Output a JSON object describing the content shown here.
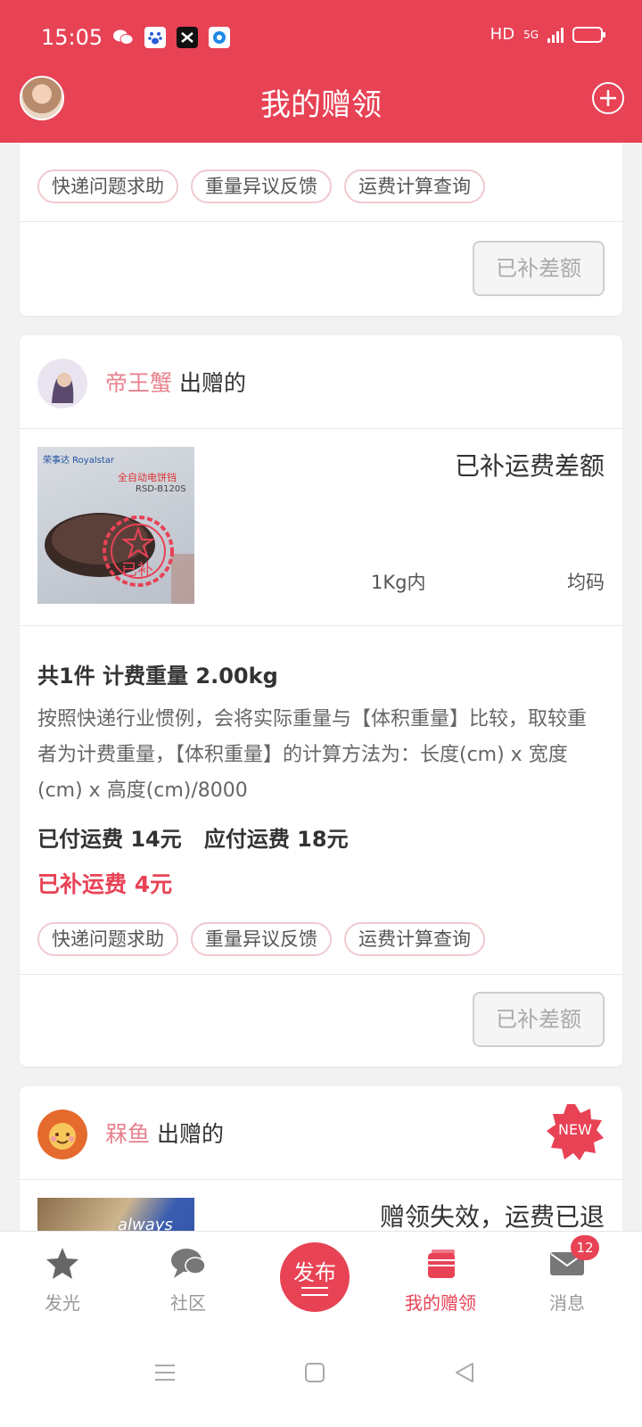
{
  "status_bar": {
    "time": "15:05",
    "hd": "HD",
    "network": "5G"
  },
  "header": {
    "title": "我的赠领"
  },
  "colors": {
    "primary": "#e84255",
    "giver_name": "#e8838f",
    "tag_border": "#f0c9ce"
  },
  "cards": [
    {
      "tags": [
        "快递问题求助",
        "重量异议反馈",
        "运费计算查询"
      ],
      "action_label": "已补差额"
    },
    {
      "giver_name": "帝王蟹",
      "giver_suffix": "出赠的",
      "product_status": "已补运费差额",
      "weight_range": "1Kg内",
      "size": "均码",
      "stamp_text": "已补",
      "product_brand": "荣事达 Royalstar",
      "product_model": "RSD-B120S",
      "product_name": "全自动电饼铛",
      "summary": "共1件 计费重量 2.00kg",
      "description": "按照快递行业惯例，会将实际重量与【体积重量】比较，取较重者为计费重量，【体积重量】的计算方法为：长度(cm) x 宽度(cm) x 高度(cm)/8000",
      "fee_line": "已付运费 14元   应付运费 18元",
      "fee_paid": "已补运费 4元",
      "tags": [
        "快递问题求助",
        "重量异议反馈",
        "运费计算查询"
      ],
      "action_label": "已补差额"
    },
    {
      "giver_name": "槑鱼",
      "giver_suffix": "出赠的",
      "badge": "NEW",
      "product_status": "赠领失效，运费已退",
      "product_label": "always"
    }
  ],
  "bottom_nav": {
    "items": [
      {
        "label": "发光",
        "icon": "star-icon"
      },
      {
        "label": "社区",
        "icon": "chat-bubble-icon"
      },
      {
        "label": "我的赠领",
        "icon": "gift-box-icon"
      },
      {
        "label": "消息",
        "icon": "mail-icon",
        "badge": "12"
      }
    ],
    "publish_label": "发布"
  }
}
